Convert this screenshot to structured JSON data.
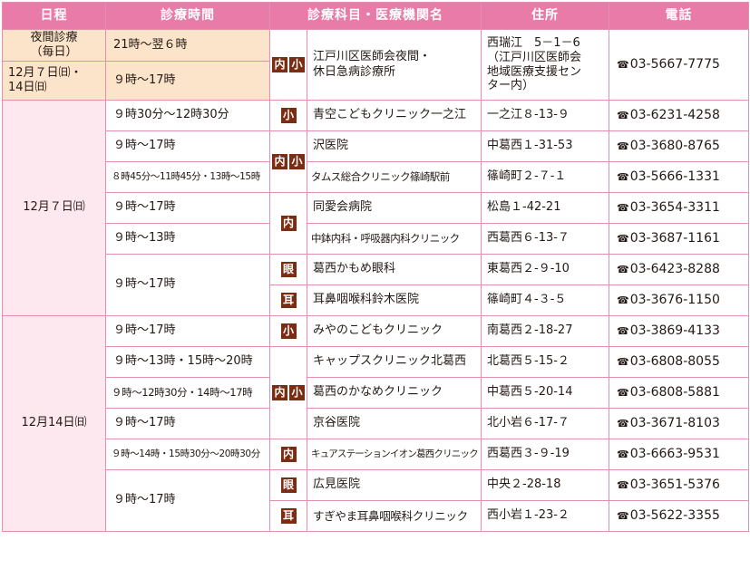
{
  "headers": [
    "日程",
    "診療時間",
    "診療科目・医療機関名",
    "住所",
    "電話"
  ],
  "badges": {
    "naika": "内",
    "shoni": "小",
    "ganka": "眼",
    "jibika": "耳"
  },
  "phone_icon": "☎",
  "night": {
    "date1": "夜間診療\n（毎日）",
    "date2": "12月７日㈰・\n14日㈰",
    "time1": "21時～翌６時",
    "time2": "９時～17時",
    "name": "江戸川区医師会夜間・\n休日急病診療所",
    "address": "西瑞江　5－1－6\n（江戸川区医師会\n地域医療支援セン\nター内）",
    "tel": "03-5667-7775"
  },
  "day1": {
    "date": "12月７日㈰",
    "rows": [
      {
        "time": "９時30分～12時30分",
        "name": "青空こどもクリニック一之江",
        "address": "一之江８-13-９",
        "tel": "03-6231-4258"
      },
      {
        "time": "９時～17時",
        "name": "沢医院",
        "address": "中葛西１-31-53",
        "tel": "03-3680-8765"
      },
      {
        "time": "８時45分～11時45分・13時～15時",
        "name": "タムス総合クリニック篠崎駅前",
        "address": "篠崎町２-７-１",
        "tel": "03-5666-1331"
      },
      {
        "time": "９時～17時",
        "name": "同愛会病院",
        "address": "松島１-42-21",
        "tel": "03-3654-3311"
      },
      {
        "time": "９時～13時",
        "name": "中鉢内科・呼吸器内科クリニック",
        "address": "西葛西６-13-７",
        "tel": "03-3687-1161"
      },
      {
        "time": "９時～17時",
        "name": "葛西かもめ眼科",
        "address": "東葛西２-９-10",
        "tel": "03-6423-8288"
      },
      {
        "name": "耳鼻咽喉科鈴木医院",
        "address": "篠崎町４-３-５",
        "tel": "03-3676-1150"
      }
    ]
  },
  "day2": {
    "date": "12月14日㈰",
    "rows": [
      {
        "time": "９時～17時",
        "name": "みやのこどもクリニック",
        "address": "南葛西２-18-27",
        "tel": "03-3869-4133"
      },
      {
        "time": "９時～13時・15時～20時",
        "name": "キャップスクリニック北葛西",
        "address": "北葛西５-15-２",
        "tel": "03-6808-8055"
      },
      {
        "time": "９時～12時30分・14時～17時",
        "name": "葛西のかなめクリニック",
        "address": "中葛西５-20-14",
        "tel": "03-6808-5881"
      },
      {
        "time": "９時～17時",
        "name": "京谷医院",
        "address": "北小岩６-17-７",
        "tel": "03-3671-8103"
      },
      {
        "time": "９時～14時・15時30分～20時30分",
        "name": "キュアステーションイオン葛西クリニック",
        "address": "西葛西３-９-19",
        "tel": "03-6663-9531"
      },
      {
        "time": "９時～17時",
        "name": "広見医院",
        "address": "中央２-28-18",
        "tel": "03-3651-5376"
      },
      {
        "name": "すぎやま耳鼻咽喉科クリニック",
        "address": "西小岩１-23-２",
        "tel": "03-5622-3355"
      }
    ]
  }
}
